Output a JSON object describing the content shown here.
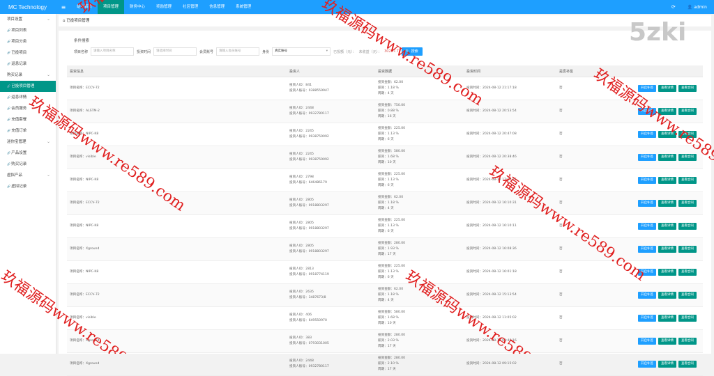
{
  "brand": "MC Technology",
  "nav": [
    "站台首页",
    "项目管理",
    "财务中心",
    "奖励管理",
    "社区管理",
    "信息管理",
    "系统管理"
  ],
  "nav_active_index": 1,
  "user": "admin",
  "sidebar": [
    {
      "label": "项目设置",
      "group": true
    },
    {
      "label": "项目列表"
    },
    {
      "label": "项目分类"
    },
    {
      "label": "已投项目"
    },
    {
      "label": "返息记录"
    },
    {
      "label": "购买记录",
      "group": true
    },
    {
      "label": "已投项目管理",
      "active": true
    },
    {
      "label": "返息详情"
    },
    {
      "label": "会员服务"
    },
    {
      "label": "充值套餐"
    },
    {
      "label": "充值订单"
    },
    {
      "label": "迷你宝管理",
      "group": true
    },
    {
      "label": "产品设置"
    },
    {
      "label": "购买记录"
    },
    {
      "label": "虚拟产品",
      "group": true
    },
    {
      "label": "虚拟记录"
    }
  ],
  "breadcrumb": "已投项目管理",
  "search": {
    "title": "条件搜索",
    "label_name": "项目名称",
    "placeholder_name": "请输入项目名称",
    "label_time": "投资时间",
    "placeholder_time": "请选择时间",
    "label_account": "会员账号",
    "placeholder_account": "请输入会员账号",
    "label_identity": "身份",
    "identity_value": "真实账号",
    "stat_invested": "已投额（元）：",
    "stat_income": "未收益（元）：",
    "income_value": "30287.7",
    "button": "搜索"
  },
  "columns": [
    "投资信息",
    "投资人",
    "投资数据",
    "投资时间",
    "是否补签"
  ],
  "buttons": {
    "resign": "开启补签",
    "detail": "查看详情",
    "contract": "查看合同"
  },
  "rows": [
    {
      "project": "项目名称：ECCV-72",
      "uid": "投资人ID：841",
      "account": "投资人账号：0388559947",
      "amount": "投资金额：62.00",
      "rate": "薪资：1.18 %",
      "period": "周期：4 天",
      "time": "投资时间：2024-08-12 21:17:18",
      "resign": "否"
    },
    {
      "project": "项目名称：ALSTM-2",
      "uid": "投资人ID：2448",
      "account": "投资人账号：0932780117",
      "amount": "投资金额：750.00",
      "rate": "薪资：0.88 %",
      "period": "周期：16 天",
      "time": "投资时间：2024-08-12 20:53:54",
      "resign": "否"
    },
    {
      "project": "项目名称：NIPC-K8",
      "uid": "投资人ID：2245",
      "account": "投资人账号：0938759092",
      "amount": "投资金额：225.00",
      "rate": "薪资：1.13 %",
      "period": "周期：6 天",
      "time": "投资时间：2024-08-12 20:47:08",
      "resign": "否"
    },
    {
      "project": "项目名称：visible",
      "uid": "投资人ID：2245",
      "account": "投资人账号：0938759092",
      "amount": "投资金额：580.00",
      "rate": "薪资：1.68 %",
      "period": "周期：10 天",
      "time": "投资时间：2024-08-12 20:38:46",
      "resign": "否"
    },
    {
      "project": "项目名称：NIPC-K8",
      "uid": "投资人ID：2798",
      "account": "投资人账号：646486179",
      "amount": "投资金额：225.00",
      "rate": "薪资：1.13 %",
      "period": "周期：6 天",
      "time": "投资时间：2024-08-12 17:54:16",
      "resign": "否"
    },
    {
      "project": "项目名称：ECCV-72",
      "uid": "投资人ID：2805",
      "account": "投资人账号：0918803297",
      "amount": "投资金额：62.00",
      "rate": "薪资：1.18 %",
      "period": "周期：4 天",
      "time": "投资时间：2024-08-12 16:10:31",
      "resign": "否"
    },
    {
      "project": "项目名称：NIPC-K8",
      "uid": "投资人ID：2805",
      "account": "投资人账号：0918803297",
      "amount": "投资金额：225.00",
      "rate": "薪资：1.13 %",
      "period": "周期：6 天",
      "time": "投资时间：2024-08-12 16:10:11",
      "resign": "否"
    },
    {
      "project": "项目名称：Xground",
      "uid": "投资人ID：2805",
      "account": "投资人账号：0918803297",
      "amount": "投资金额：280.00",
      "rate": "薪资：1.93 %",
      "period": "周期：17 天",
      "time": "投资时间：2024-08-12 16:08:36",
      "resign": "否"
    },
    {
      "project": "项目名称：NIPC-K8",
      "uid": "投资人ID：2813",
      "account": "投资人账号：0918774119",
      "amount": "投资金额：225.00",
      "rate": "薪资：1.13 %",
      "period": "周期：6 天",
      "time": "投资时间：2024-08-12 16:01:18",
      "resign": "否"
    },
    {
      "project": "项目名称：ECCV-72",
      "uid": "投资人ID：2635",
      "account": "投资人账号：3487673/8",
      "amount": "投资金额：62.00",
      "rate": "薪资：1.18 %",
      "period": "周期：4 天",
      "time": "投资时间：2024-08-12 15:13:54",
      "resign": "否"
    },
    {
      "project": "项目名称：visible",
      "uid": "投资人ID：406",
      "account": "投资人账号：649550970",
      "amount": "投资金额：580.00",
      "rate": "薪资：1.68 %",
      "period": "周期：10 天",
      "time": "投资时间：2024-08-12 11:05:02",
      "resign": "否"
    },
    {
      "project": "项目名称：Xground",
      "uid": "投资人ID：383",
      "account": "投资人账号：0793031005",
      "amount": "投资金额：280.00",
      "rate": "薪资：2.03 %",
      "period": "周期：17 天",
      "time": "投资时间：2024-08-12 09:48:16",
      "resign": "否"
    },
    {
      "project": "项目名称：Xground",
      "uid": "投资人ID：2448",
      "account": "投资人账号：0932780117",
      "amount": "投资金额：280.00",
      "rate": "薪资：2.10 %",
      "period": "周期：17 天",
      "time": "投资时间：2024-08-12 09:15:02",
      "resign": "否"
    }
  ],
  "watermark_text": "玖福源码www.re589.com",
  "corner_logo": "5zki"
}
